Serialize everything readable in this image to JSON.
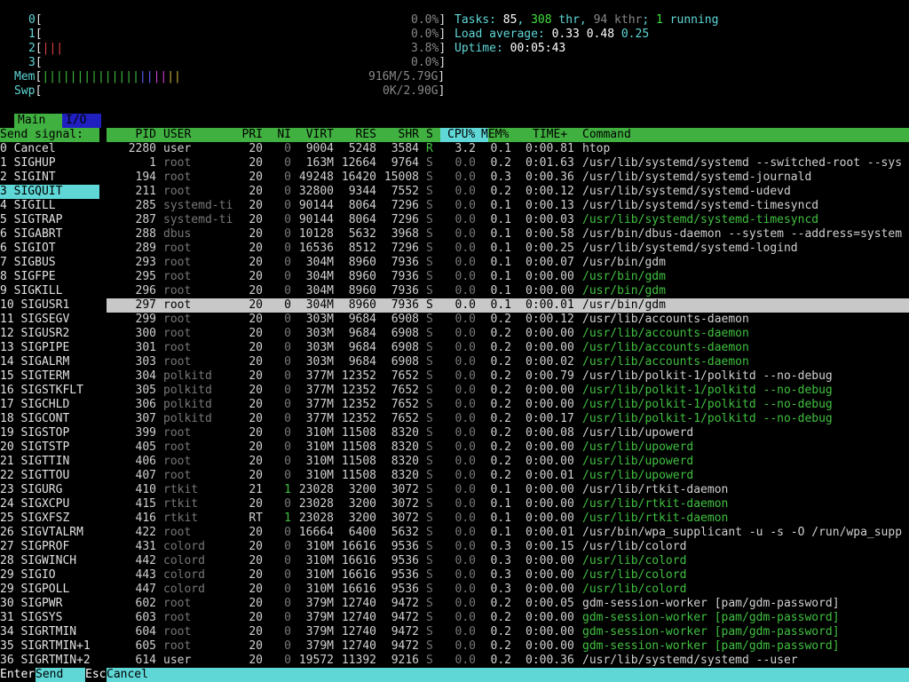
{
  "meters": {
    "cpus": [
      {
        "label": "0",
        "value": "0.0%"
      },
      {
        "label": "1",
        "value": "0.0%"
      },
      {
        "label": "2",
        "value": "3.8%",
        "bars": "|||"
      },
      {
        "label": "3",
        "value": "0.0%"
      }
    ],
    "mem": {
      "label": "Mem",
      "value": "916M/5.79G",
      "bars": "||||||||||||||||||||"
    },
    "swp": {
      "label": "Swp",
      "value": "0K/2.90G"
    }
  },
  "stats": {
    "tasks_label": "Tasks: ",
    "tasks": "85",
    "thr": "308",
    "thr_label": " thr, ",
    "kthr": "94 kthr",
    "running": "1",
    "running_label": " running",
    "load_label": "Load average: ",
    "load1": "0.33",
    "load5": "0.48",
    "load15": "0.25",
    "uptime_label": "Uptime: ",
    "uptime": "00:05:43"
  },
  "tabs": {
    "main": "Main",
    "io": "I/O"
  },
  "signal_title": "Send signal:",
  "columns": {
    "pid": "PID",
    "user": "USER",
    "pri": "PRI",
    "ni": "NI",
    "virt": "VIRT",
    "res": "RES",
    "shr": "SHR",
    "s": "S",
    "cpu": "CPU%",
    "mem": "MEM%",
    "time": "TIME+",
    "command": "Command"
  },
  "signals": [
    "0 Cancel",
    "1 SIGHUP",
    "2 SIGINT",
    "3 SIGQUIT",
    "4 SIGILL",
    "5 SIGTRAP",
    "6 SIGABRT",
    "6 SIGIOT",
    "7 SIGBUS",
    "8 SIGFPE",
    "9 SIGKILL",
    "10 SIGUSR1",
    "11 SIGSEGV",
    "12 SIGUSR2",
    "13 SIGPIPE",
    "14 SIGALRM",
    "15 SIGTERM",
    "16 SIGSTKFLT",
    "17 SIGCHLD",
    "18 SIGCONT",
    "19 SIGSTOP",
    "20 SIGTSTP",
    "21 SIGTTIN",
    "22 SIGTTOU",
    "23 SIGURG",
    "24 SIGXCPU",
    "25 SIGXFSZ",
    "26 SIGVTALRM",
    "27 SIGPROF",
    "28 SIGWINCH",
    "29 SIGIO",
    "29 SIGPOLL",
    "30 SIGPWR",
    "31 SIGSYS",
    "34 SIGRTMIN",
    "35 SIGRTMIN+1",
    "36 SIGRTMIN+2"
  ],
  "selected_signal": 3,
  "processes": [
    {
      "pid": "2280",
      "user": "user",
      "pri": "20",
      "ni": "0",
      "virt": "9004",
      "res": "5248",
      "shr": "3584",
      "s": "R",
      "cpu": "3.2",
      "mem": "0.1",
      "time": "0:00.81",
      "cmd": "htop",
      "thread": false
    },
    {
      "pid": "1",
      "user": "root",
      "pri": "20",
      "ni": "0",
      "virt": "163M",
      "res": "12664",
      "shr": "9764",
      "s": "S",
      "cpu": "0.0",
      "mem": "0.2",
      "time": "0:01.63",
      "cmd": "/usr/lib/systemd/systemd --switched-root --sys",
      "thread": false
    },
    {
      "pid": "194",
      "user": "root",
      "pri": "20",
      "ni": "0",
      "virt": "49248",
      "res": "16420",
      "shr": "15008",
      "s": "S",
      "cpu": "0.0",
      "mem": "0.3",
      "time": "0:00.36",
      "cmd": "/usr/lib/systemd/systemd-journald",
      "thread": false
    },
    {
      "pid": "211",
      "user": "root",
      "pri": "20",
      "ni": "0",
      "virt": "32800",
      "res": "9344",
      "shr": "7552",
      "s": "S",
      "cpu": "0.0",
      "mem": "0.2",
      "time": "0:00.12",
      "cmd": "/usr/lib/systemd/systemd-udevd",
      "thread": false
    },
    {
      "pid": "285",
      "user": "systemd-ti",
      "pri": "20",
      "ni": "0",
      "virt": "90144",
      "res": "8064",
      "shr": "7296",
      "s": "S",
      "cpu": "0.0",
      "mem": "0.1",
      "time": "0:00.13",
      "cmd": "/usr/lib/systemd/systemd-timesyncd",
      "thread": false
    },
    {
      "pid": "287",
      "user": "systemd-ti",
      "pri": "20",
      "ni": "0",
      "virt": "90144",
      "res": "8064",
      "shr": "7296",
      "s": "S",
      "cpu": "0.0",
      "mem": "0.1",
      "time": "0:00.03",
      "cmd": "/usr/lib/systemd/systemd-timesyncd",
      "thread": true
    },
    {
      "pid": "288",
      "user": "dbus",
      "pri": "20",
      "ni": "0",
      "virt": "10128",
      "res": "5632",
      "shr": "3968",
      "s": "S",
      "cpu": "0.0",
      "mem": "0.1",
      "time": "0:00.58",
      "cmd": "/usr/bin/dbus-daemon --system --address=system",
      "thread": false
    },
    {
      "pid": "289",
      "user": "root",
      "pri": "20",
      "ni": "0",
      "virt": "16536",
      "res": "8512",
      "shr": "7296",
      "s": "S",
      "cpu": "0.0",
      "mem": "0.1",
      "time": "0:00.25",
      "cmd": "/usr/lib/systemd/systemd-logind",
      "thread": false
    },
    {
      "pid": "293",
      "user": "root",
      "pri": "20",
      "ni": "0",
      "virt": "304M",
      "res": "8960",
      "shr": "7936",
      "s": "S",
      "cpu": "0.0",
      "mem": "0.1",
      "time": "0:00.07",
      "cmd": "/usr/bin/gdm",
      "thread": false
    },
    {
      "pid": "295",
      "user": "root",
      "pri": "20",
      "ni": "0",
      "virt": "304M",
      "res": "8960",
      "shr": "7936",
      "s": "S",
      "cpu": "0.0",
      "mem": "0.1",
      "time": "0:00.00",
      "cmd": "/usr/bin/gdm",
      "thread": true
    },
    {
      "pid": "296",
      "user": "root",
      "pri": "20",
      "ni": "0",
      "virt": "304M",
      "res": "8960",
      "shr": "7936",
      "s": "S",
      "cpu": "0.0",
      "mem": "0.1",
      "time": "0:00.00",
      "cmd": "/usr/bin/gdm",
      "thread": true
    },
    {
      "pid": "297",
      "user": "root",
      "pri": "20",
      "ni": "0",
      "virt": "304M",
      "res": "8960",
      "shr": "7936",
      "s": "S",
      "cpu": "0.0",
      "mem": "0.1",
      "time": "0:00.01",
      "cmd": "/usr/bin/gdm",
      "thread": true,
      "selected": true
    },
    {
      "pid": "299",
      "user": "root",
      "pri": "20",
      "ni": "0",
      "virt": "303M",
      "res": "9684",
      "shr": "6908",
      "s": "S",
      "cpu": "0.0",
      "mem": "0.2",
      "time": "0:00.12",
      "cmd": "/usr/lib/accounts-daemon",
      "thread": false
    },
    {
      "pid": "300",
      "user": "root",
      "pri": "20",
      "ni": "0",
      "virt": "303M",
      "res": "9684",
      "shr": "6908",
      "s": "S",
      "cpu": "0.0",
      "mem": "0.2",
      "time": "0:00.00",
      "cmd": "/usr/lib/accounts-daemon",
      "thread": true
    },
    {
      "pid": "301",
      "user": "root",
      "pri": "20",
      "ni": "0",
      "virt": "303M",
      "res": "9684",
      "shr": "6908",
      "s": "S",
      "cpu": "0.0",
      "mem": "0.2",
      "time": "0:00.00",
      "cmd": "/usr/lib/accounts-daemon",
      "thread": true
    },
    {
      "pid": "303",
      "user": "root",
      "pri": "20",
      "ni": "0",
      "virt": "303M",
      "res": "9684",
      "shr": "6908",
      "s": "S",
      "cpu": "0.0",
      "mem": "0.2",
      "time": "0:00.02",
      "cmd": "/usr/lib/accounts-daemon",
      "thread": true
    },
    {
      "pid": "304",
      "user": "polkitd",
      "pri": "20",
      "ni": "0",
      "virt": "377M",
      "res": "12352",
      "shr": "7652",
      "s": "S",
      "cpu": "0.0",
      "mem": "0.2",
      "time": "0:00.79",
      "cmd": "/usr/lib/polkit-1/polkitd --no-debug",
      "thread": false
    },
    {
      "pid": "305",
      "user": "polkitd",
      "pri": "20",
      "ni": "0",
      "virt": "377M",
      "res": "12352",
      "shr": "7652",
      "s": "S",
      "cpu": "0.0",
      "mem": "0.2",
      "time": "0:00.00",
      "cmd": "/usr/lib/polkit-1/polkitd --no-debug",
      "thread": true
    },
    {
      "pid": "306",
      "user": "polkitd",
      "pri": "20",
      "ni": "0",
      "virt": "377M",
      "res": "12352",
      "shr": "7652",
      "s": "S",
      "cpu": "0.0",
      "mem": "0.2",
      "time": "0:00.00",
      "cmd": "/usr/lib/polkit-1/polkitd --no-debug",
      "thread": true
    },
    {
      "pid": "307",
      "user": "polkitd",
      "pri": "20",
      "ni": "0",
      "virt": "377M",
      "res": "12352",
      "shr": "7652",
      "s": "S",
      "cpu": "0.0",
      "mem": "0.2",
      "time": "0:00.17",
      "cmd": "/usr/lib/polkit-1/polkitd --no-debug",
      "thread": true
    },
    {
      "pid": "399",
      "user": "root",
      "pri": "20",
      "ni": "0",
      "virt": "310M",
      "res": "11508",
      "shr": "8320",
      "s": "S",
      "cpu": "0.0",
      "mem": "0.2",
      "time": "0:00.08",
      "cmd": "/usr/lib/upowerd",
      "thread": false
    },
    {
      "pid": "405",
      "user": "root",
      "pri": "20",
      "ni": "0",
      "virt": "310M",
      "res": "11508",
      "shr": "8320",
      "s": "S",
      "cpu": "0.0",
      "mem": "0.2",
      "time": "0:00.00",
      "cmd": "/usr/lib/upowerd",
      "thread": true
    },
    {
      "pid": "406",
      "user": "root",
      "pri": "20",
      "ni": "0",
      "virt": "310M",
      "res": "11508",
      "shr": "8320",
      "s": "S",
      "cpu": "0.0",
      "mem": "0.2",
      "time": "0:00.00",
      "cmd": "/usr/lib/upowerd",
      "thread": true
    },
    {
      "pid": "407",
      "user": "root",
      "pri": "20",
      "ni": "0",
      "virt": "310M",
      "res": "11508",
      "shr": "8320",
      "s": "S",
      "cpu": "0.0",
      "mem": "0.2",
      "time": "0:00.01",
      "cmd": "/usr/lib/upowerd",
      "thread": true
    },
    {
      "pid": "410",
      "user": "rtkit",
      "pri": "21",
      "ni": "1",
      "virt": "23028",
      "res": "3200",
      "shr": "3072",
      "s": "S",
      "cpu": "0.0",
      "mem": "0.1",
      "time": "0:00.00",
      "cmd": "/usr/lib/rtkit-daemon",
      "thread": false
    },
    {
      "pid": "415",
      "user": "rtkit",
      "pri": "20",
      "ni": "0",
      "virt": "23028",
      "res": "3200",
      "shr": "3072",
      "s": "S",
      "cpu": "0.0",
      "mem": "0.1",
      "time": "0:00.00",
      "cmd": "/usr/lib/rtkit-daemon",
      "thread": true
    },
    {
      "pid": "416",
      "user": "rtkit",
      "pri": "RT",
      "ni": "1",
      "virt": "23028",
      "res": "3200",
      "shr": "3072",
      "s": "S",
      "cpu": "0.0",
      "mem": "0.1",
      "time": "0:00.00",
      "cmd": "/usr/lib/rtkit-daemon",
      "thread": true
    },
    {
      "pid": "422",
      "user": "root",
      "pri": "20",
      "ni": "0",
      "virt": "16664",
      "res": "6400",
      "shr": "5632",
      "s": "S",
      "cpu": "0.0",
      "mem": "0.1",
      "time": "0:00.01",
      "cmd": "/usr/bin/wpa_supplicant -u -s -O /run/wpa_supp",
      "thread": false
    },
    {
      "pid": "431",
      "user": "colord",
      "pri": "20",
      "ni": "0",
      "virt": "310M",
      "res": "16616",
      "shr": "9536",
      "s": "S",
      "cpu": "0.0",
      "mem": "0.3",
      "time": "0:00.15",
      "cmd": "/usr/lib/colord",
      "thread": false
    },
    {
      "pid": "442",
      "user": "colord",
      "pri": "20",
      "ni": "0",
      "virt": "310M",
      "res": "16616",
      "shr": "9536",
      "s": "S",
      "cpu": "0.0",
      "mem": "0.3",
      "time": "0:00.00",
      "cmd": "/usr/lib/colord",
      "thread": true
    },
    {
      "pid": "443",
      "user": "colord",
      "pri": "20",
      "ni": "0",
      "virt": "310M",
      "res": "16616",
      "shr": "9536",
      "s": "S",
      "cpu": "0.0",
      "mem": "0.3",
      "time": "0:00.00",
      "cmd": "/usr/lib/colord",
      "thread": true
    },
    {
      "pid": "447",
      "user": "colord",
      "pri": "20",
      "ni": "0",
      "virt": "310M",
      "res": "16616",
      "shr": "9536",
      "s": "S",
      "cpu": "0.0",
      "mem": "0.3",
      "time": "0:00.00",
      "cmd": "/usr/lib/colord",
      "thread": true
    },
    {
      "pid": "602",
      "user": "root",
      "pri": "20",
      "ni": "0",
      "virt": "379M",
      "res": "12740",
      "shr": "9472",
      "s": "S",
      "cpu": "0.0",
      "mem": "0.2",
      "time": "0:00.05",
      "cmd": "gdm-session-worker [pam/gdm-password]",
      "thread": false
    },
    {
      "pid": "603",
      "user": "root",
      "pri": "20",
      "ni": "0",
      "virt": "379M",
      "res": "12740",
      "shr": "9472",
      "s": "S",
      "cpu": "0.0",
      "mem": "0.2",
      "time": "0:00.00",
      "cmd": "gdm-session-worker [pam/gdm-password]",
      "thread": true
    },
    {
      "pid": "604",
      "user": "root",
      "pri": "20",
      "ni": "0",
      "virt": "379M",
      "res": "12740",
      "shr": "9472",
      "s": "S",
      "cpu": "0.0",
      "mem": "0.2",
      "time": "0:00.00",
      "cmd": "gdm-session-worker [pam/gdm-password]",
      "thread": true
    },
    {
      "pid": "605",
      "user": "root",
      "pri": "20",
      "ni": "0",
      "virt": "379M",
      "res": "12740",
      "shr": "9472",
      "s": "S",
      "cpu": "0.0",
      "mem": "0.2",
      "time": "0:00.00",
      "cmd": "gdm-session-worker [pam/gdm-password]",
      "thread": true
    },
    {
      "pid": "614",
      "user": "user",
      "pri": "20",
      "ni": "0",
      "virt": "19572",
      "res": "11392",
      "shr": "9216",
      "s": "S",
      "cpu": "0.0",
      "mem": "0.2",
      "time": "0:00.36",
      "cmd": "/usr/lib/systemd/systemd --user",
      "thread": false
    }
  ],
  "footer": {
    "enter_key": "Enter",
    "enter_label": "Send",
    "esc_key": "Esc",
    "esc_label": "Cancel"
  },
  "colors": {
    "accent": "#40b040",
    "cyan": "#5fd7d7",
    "selection": "#c8c8c8",
    "thread": "#40c040"
  }
}
